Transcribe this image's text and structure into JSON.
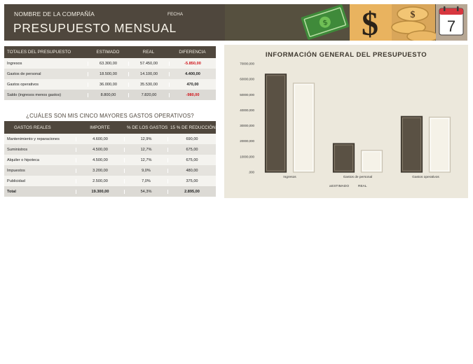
{
  "header": {
    "company": "NOMBRE DE LA COMPAÑÍA",
    "date_label": "FECHA",
    "title": "PRESUPUESTO MENSUAL"
  },
  "totals": {
    "headers": [
      "TOTALES DEL PRESUPUESTO",
      "ESTIMADO",
      "REAL",
      "DIFERENCIA"
    ],
    "rows": [
      {
        "label": "Ingresos",
        "estimado": "63.300,00",
        "real": "57.450,00",
        "diferencia": "-5.850,00"
      },
      {
        "label": "Gastos de personal",
        "estimado": "18.500,00",
        "real": "14.100,00",
        "diferencia": "4.400,00"
      },
      {
        "label": "Gastos operativos",
        "estimado": "36.000,00",
        "real": "35.530,00",
        "diferencia": "470,00"
      },
      {
        "label": "Saldo (ingresos menos gastos)",
        "estimado": "8.800,00",
        "real": "7.820,00",
        "diferencia": "-980,00"
      }
    ]
  },
  "expenses": {
    "question": "¿CUÁLES SON MIS CINCO MAYORES GASTOS OPERATIVOS?",
    "headers": [
      "GASTOS REALES",
      "IMPORTE",
      "% DE LOS GASTOS",
      "15 % DE REDUCCIÓN"
    ],
    "rows": [
      {
        "label": "Mantenimiento y reparaciones",
        "importe": "4.600,00",
        "pct": "12,9%",
        "reduccion": "690,00"
      },
      {
        "label": "Suministros",
        "importe": "4.500,00",
        "pct": "12,7%",
        "reduccion": "675,00"
      },
      {
        "label": "Alquiler o hipoteca",
        "importe": "4.500,00",
        "pct": "12,7%",
        "reduccion": "675,00"
      },
      {
        "label": "Impuestos",
        "importe": "3.200,00",
        "pct": "9,0%",
        "reduccion": "480,00"
      },
      {
        "label": "Publicidad",
        "importe": "2.500,00",
        "pct": "7,0%",
        "reduccion": "375,00"
      }
    ],
    "total": {
      "label": "Total",
      "importe": "19.300,00",
      "pct": "54,3%",
      "reduccion": "2.895,00"
    }
  },
  "chart_data": {
    "type": "bar",
    "title": "INFORMACIÓN GENERAL DEL PRESUPUESTO",
    "categories": [
      "Ingresos",
      "Gastos de personal",
      "Gastos operativos"
    ],
    "series": [
      {
        "name": "ESTIMADO",
        "values": [
          63300,
          18500,
          36000
        ],
        "color": "#5a5144"
      },
      {
        "name": "REAL",
        "values": [
          57450,
          14100,
          35530
        ],
        "color": "#f5f2e8"
      }
    ],
    "yticks": [
      ".000",
      "10000,000",
      "20000,000",
      "30000,000",
      "40000,000",
      "50000,000",
      "60000,000",
      "70000,000"
    ],
    "ylim": [
      0,
      70000
    ],
    "legend": "bottom",
    "legend_markers": [
      "a",
      ""
    ]
  },
  "colors": {
    "header_dark": "#4f473d",
    "negative": "#d0141a",
    "chart_bg": "#ece8dc"
  },
  "icons": [
    "money-bill-icon",
    "dollar-sign-icon",
    "coins-icon",
    "calendar-icon"
  ],
  "calendar_day": "7"
}
